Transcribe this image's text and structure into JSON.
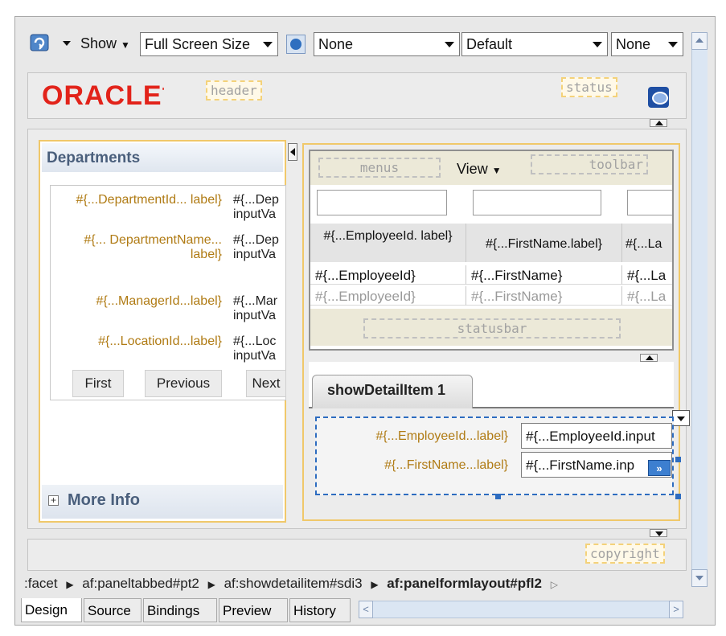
{
  "toolbar": {
    "show_label": "Show",
    "screen_size": "Full Screen Size",
    "combo_skin": "None",
    "combo_default": "Default",
    "combo_none2": "None"
  },
  "header": {
    "brand": "ORACLE",
    "brand_color": "#e2231a",
    "header_facet": "header",
    "status_facet": "status"
  },
  "departments": {
    "title": "Departments",
    "fields": [
      {
        "label": "#{...DepartmentId... label}",
        "value": "#{...Dep inputVa"
      },
      {
        "label": "#{... DepartmentName... label}",
        "value": "#{...Dep inputVa"
      },
      {
        "label": "#{...ManagerId...label}",
        "value": "#{...Mar inputVa"
      },
      {
        "label": "#{...LocationId...label}",
        "value": "#{...Loc inputVa"
      }
    ],
    "nav": [
      "First",
      "Previous",
      "Next"
    ],
    "more_info": "More Info"
  },
  "employees_table": {
    "menus_facet": "menus",
    "view_menu": "View",
    "toolbar_facet": "toolbar",
    "statusbar_facet": "statusbar",
    "columns": [
      "#{...EmployeeId. label}",
      "#{...FirstName.label}",
      "#{...La"
    ],
    "rows": [
      [
        "#{...EmployeeId}",
        "#{...FirstName}",
        "#{...La"
      ],
      [
        "#{...EmployeeId}",
        "#{...FirstName}",
        "#{...La"
      ]
    ]
  },
  "detail": {
    "tab_label": "showDetailItem 1",
    "fields": [
      {
        "label": "#{...EmployeeId...label}",
        "value": "#{...EmployeeId.input"
      },
      {
        "label": "#{...FirstName...label}",
        "value": "#{...FirstName.inp"
      }
    ]
  },
  "footer": {
    "copyright_facet": "copyright",
    "breadcrumb": [
      ":facet",
      "af:paneltabbed#pt2",
      "af:showdetailitem#sdi3",
      "af:panelformlayout#pfl2"
    ],
    "editor_tabs": [
      "Design",
      "Source",
      "Bindings",
      "Preview",
      "History"
    ]
  }
}
